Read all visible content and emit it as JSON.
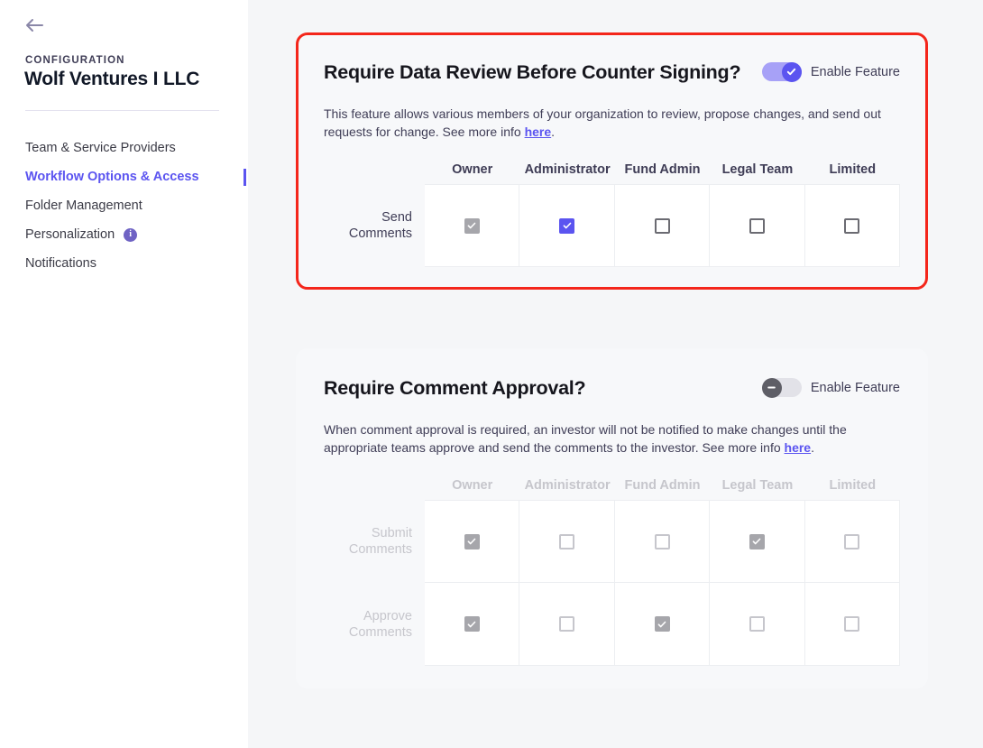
{
  "sidebar": {
    "back_icon": "arrow-left-icon",
    "section_label": "CONFIGURATION",
    "org_name": "Wolf Ventures I LLC",
    "items": [
      {
        "label": "Team & Service Providers",
        "active": false,
        "info": false
      },
      {
        "label": "Workflow Options & Access",
        "active": true,
        "info": false
      },
      {
        "label": "Folder Management",
        "active": false,
        "info": false
      },
      {
        "label": "Personalization",
        "active": false,
        "info": true
      },
      {
        "label": "Notifications",
        "active": false,
        "info": false
      }
    ],
    "info_icon_glyph": "i"
  },
  "colors": {
    "accent_purple": "#5b54f0",
    "toggle_on_track": "#a7a1f7",
    "toggle_off_knob": "#5e5e66",
    "highlight_red": "#f4261b",
    "checkbox_disabled": "#a6a6ab",
    "page_background": "#f5f6f8"
  },
  "cards": [
    {
      "id": "require-data-review",
      "title": "Require Data Review Before Counter Signing?",
      "toggle": {
        "state": "on",
        "label": "Enable Feature",
        "knob_icon": "check-icon"
      },
      "highlighted": true,
      "enabled": true,
      "description_before_link": "This feature allows various members of your organization to review, propose changes, and send out requests for change. See more info ",
      "link_text": "here",
      "description_after_link": ".",
      "table": {
        "columns": [
          "Owner",
          "Administrator",
          "Fund Admin",
          "Legal Team",
          "Limited"
        ],
        "rows": [
          {
            "label_line1": "Send",
            "label_line2": "Comments",
            "cells": [
              "checked-disabled",
              "checked-active",
              "unchecked",
              "unchecked",
              "unchecked"
            ]
          }
        ]
      }
    },
    {
      "id": "require-comment-approval",
      "title": "Require Comment Approval?",
      "toggle": {
        "state": "off",
        "label": "Enable Feature",
        "knob_icon": "minus-icon"
      },
      "highlighted": false,
      "enabled": false,
      "description_before_link": "When comment approval is required, an investor will not be notified to make changes until the appropriate teams approve and send the comments to the investor. See more info ",
      "link_text": "here",
      "description_after_link": ".",
      "table": {
        "columns": [
          "Owner",
          "Administrator",
          "Fund Admin",
          "Legal Team",
          "Limited"
        ],
        "rows": [
          {
            "label_line1": "Submit",
            "label_line2": "Comments",
            "cells": [
              "checked-disabled",
              "unchecked",
              "unchecked",
              "checked-disabled",
              "unchecked"
            ]
          },
          {
            "label_line1": "Approve",
            "label_line2": "Comments",
            "cells": [
              "checked-disabled",
              "unchecked",
              "checked-disabled",
              "unchecked",
              "unchecked"
            ]
          }
        ]
      }
    }
  ]
}
